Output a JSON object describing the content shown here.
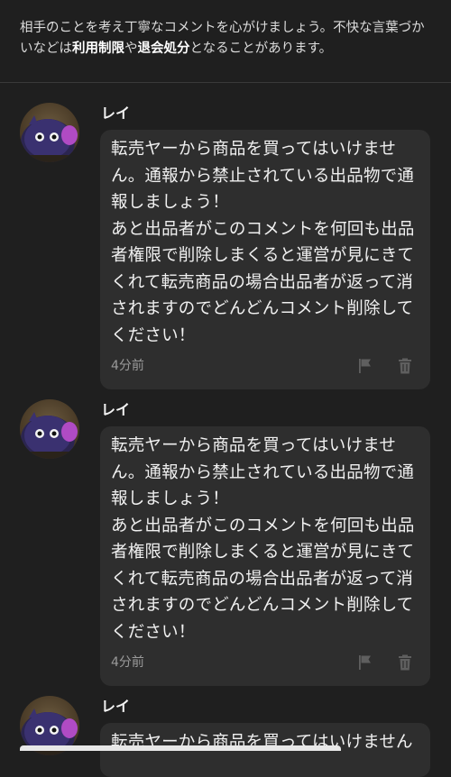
{
  "notice": {
    "text_1": "相手のことを考え丁寧なコメントを心がけましょう。不快な言葉づかいなどは",
    "bold_1": "利用制限",
    "text_2": "や",
    "bold_2": "退会処分",
    "text_3": "となることがあります。"
  },
  "comments": [
    {
      "user": "レイ",
      "body": "転売ヤーから商品を買ってはいけません。通報から禁止されている出品物で通報しましょう！\nあと出品者がこのコメントを何回も出品者権限で削除しまくると運営が見にきてくれて転売商品の場合出品者が返って消されますのでどんどんコメント削除してください！",
      "time": "4分前"
    },
    {
      "user": "レイ",
      "body": "転売ヤーから商品を買ってはいけません。通報から禁止されている出品物で通報しましょう！\nあと出品者がこのコメントを何回も出品者権限で削除しまくると運営が見にきてくれて転売商品の場合出品者が返って消されますのでどんどんコメント削除してください！",
      "time": "4分前"
    },
    {
      "user": "レイ",
      "body": "転売ヤーから商品を買ってはいけません",
      "time": ""
    }
  ],
  "icons": {
    "flag": "flag-icon",
    "trash": "trash-icon"
  },
  "colors": {
    "background": "#1f1f1f",
    "bubble": "#2e2e2e",
    "text": "#f0f0f0",
    "muted": "#9a9a9a"
  }
}
